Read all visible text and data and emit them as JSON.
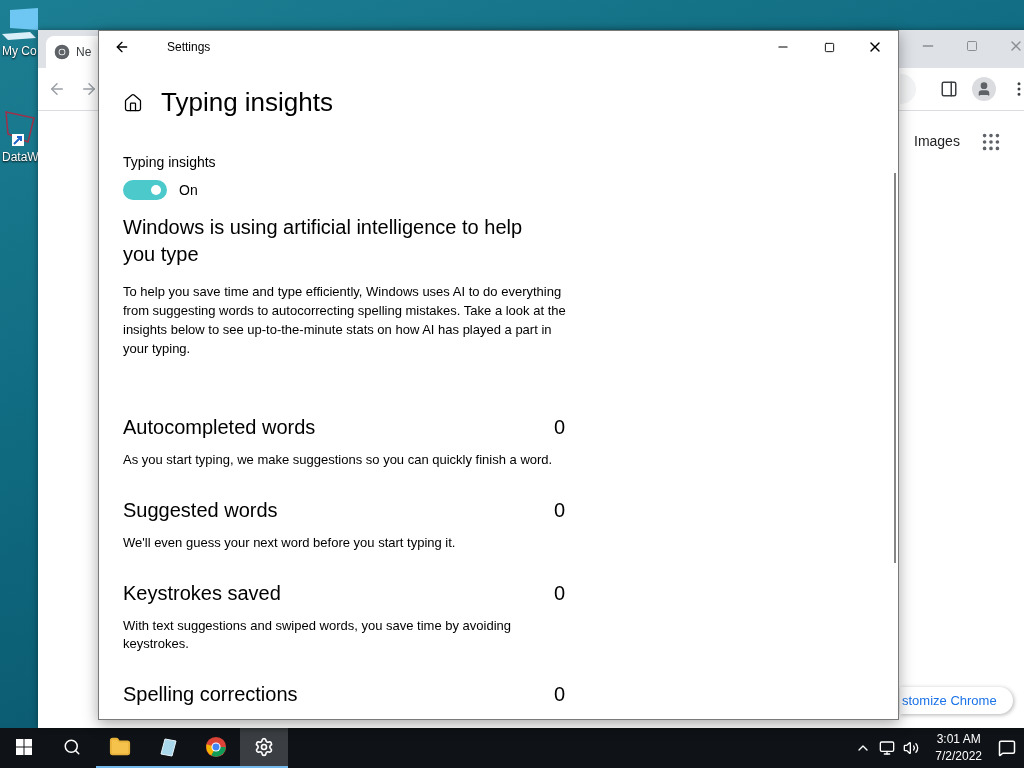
{
  "desktop_icons": [
    {
      "kind": "computer",
      "label": "My Co"
    },
    {
      "kind": "shortcut",
      "label": "DataW"
    }
  ],
  "browser": {
    "tab_title": "Ne",
    "header_link": "Images",
    "customize_button": "stomize Chrome"
  },
  "settings": {
    "title": "Settings",
    "page_title": "Typing insights",
    "toggle": {
      "label": "Typing insights",
      "on": true,
      "state_text": "On"
    },
    "heading": "Windows is using artificial intelligence to help you type",
    "description": "To help you save time and type efficiently, Windows uses AI to do everything from suggesting words to autocorrecting spelling mistakes. Take a look at the insights below to see up-to-the-minute stats on how AI has played a part in your typing.",
    "stats": [
      {
        "title": "Autocompleted words",
        "value": "0",
        "description": "As you start typing, we make suggestions so you can quickly finish a word."
      },
      {
        "title": "Suggested words",
        "value": "0",
        "description": "We'll even guess your next word before you start typing it."
      },
      {
        "title": "Keystrokes saved",
        "value": "0",
        "description": "With text suggestions and swiped words, you save time by avoiding keystrokes."
      },
      {
        "title": "Spelling corrections",
        "value": "0"
      }
    ]
  },
  "taskbar": {
    "apps": [
      {
        "kind": "explorer",
        "running": true,
        "selected": false
      },
      {
        "kind": "notes",
        "running": true,
        "selected": false
      },
      {
        "kind": "chrome",
        "running": true,
        "selected": false
      },
      {
        "kind": "settings",
        "running": true,
        "selected": true
      }
    ],
    "clock": {
      "time": "3:01 AM",
      "date": "7/2/2022"
    }
  }
}
